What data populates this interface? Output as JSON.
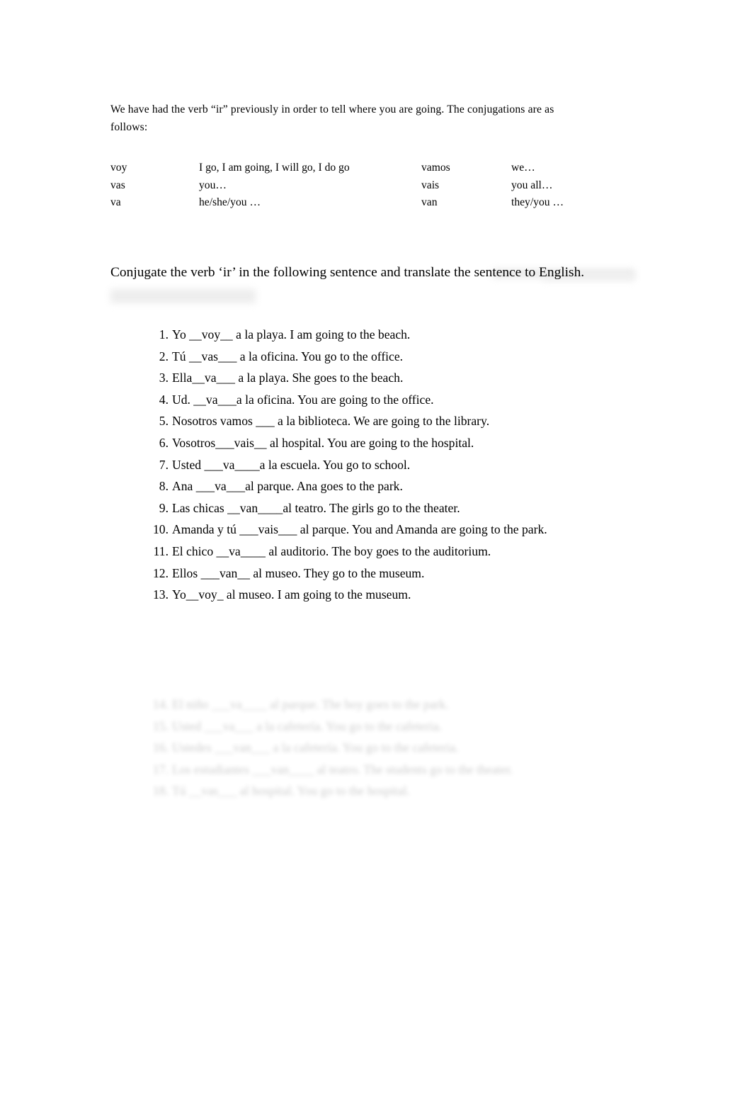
{
  "document": {
    "background_color": "#ffffff",
    "text_color": "#000000",
    "intro": "We have had the verb “ir” previously in order to tell where you are going. The conjugations are as follows:",
    "heading": "Conjugate the verb ‘ir’ in the following sentence and translate the sentence to English."
  },
  "conjugation_table": {
    "rows": [
      {
        "singular_form": "voy",
        "singular_meaning": "I go, I am going, I will go, I do go",
        "plural_form": "vamos",
        "plural_meaning": "we…"
      },
      {
        "singular_form": "vas",
        "singular_meaning": "you…",
        "plural_form": "vais",
        "plural_meaning": "you all…"
      },
      {
        "singular_form": "va",
        "singular_meaning": "he/she/you …",
        "plural_form": "van",
        "plural_meaning": "they/you …"
      }
    ]
  },
  "exercises": [
    {
      "number": "1.",
      "text": "Yo __voy__ a la playa.   I am going to the beach."
    },
    {
      "number": "2.",
      "text": "Tú __vas___  a la oficina.   You go to the office."
    },
    {
      "number": "3.",
      "text": "Ella__va___ a la playa.   She goes to the beach."
    },
    {
      "number": "4.",
      "text": "Ud. __va___a la oficina.   You are going to the office."
    },
    {
      "number": "5.",
      "text": "Nosotros vamos ___ a    la biblioteca.   We are going to the library."
    },
    {
      "number": "6.",
      "text": "Vosotros___vais__ al hospital.     You are going to the hospital."
    },
    {
      "number": "7.",
      "text": "Usted  ___va____a la escuela.    You go to school."
    },
    {
      "number": "8.",
      "text": "Ana ___va___al parque.    Ana goes to the park."
    },
    {
      "number": "9.",
      "text": "Las chicas   __van____al teatro.   The girls go to the theater."
    },
    {
      "number": "10.",
      "text": "   Amanda y tú   ___vais___ al  parque.   You and Amanda are going to the park."
    },
    {
      "number": "11.",
      "text": "   El chico  __va____ al  auditorio.   The boy goes to the auditorium."
    },
    {
      "number": "12.",
      "text": "   Ellos ___van__ al museo.    They go to the museum."
    },
    {
      "number": "13.",
      "text": "   Yo__voy_ al museo.    I am going to the museum."
    }
  ],
  "faded_exercises": [
    {
      "number": "14.",
      "text": "   El niño ___va____ al parque.    The boy goes to the park."
    },
    {
      "number": "15.",
      "text": "   Usted  ___va___ a la cafetería.     You go to the cafeteria."
    },
    {
      "number": "16.",
      "text": "   Ustedes ___van___ a la cafetería.      You go to the cafeteria."
    },
    {
      "number": "17.",
      "text": "   Los estudiantes  ___van____ al     teatro.   The students go to the theater."
    },
    {
      "number": "18.",
      "text": "   Tú  __vas___ al hospital.    You go to the hospital."
    }
  ]
}
